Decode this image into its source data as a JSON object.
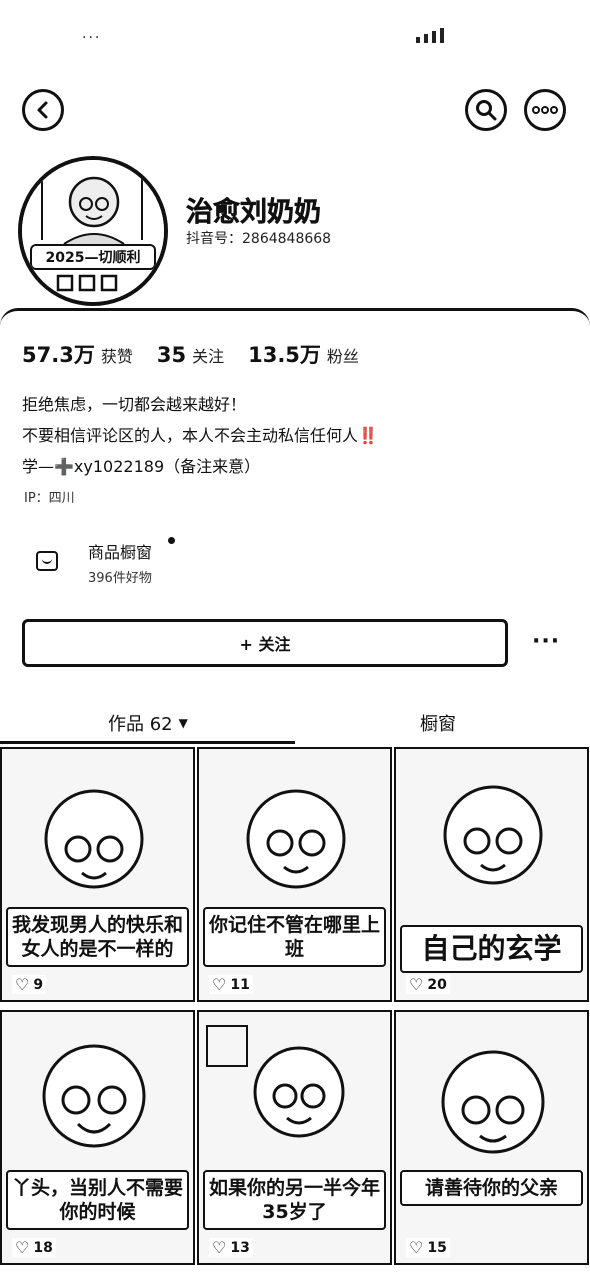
{
  "status_bar": {
    "left": "···",
    "right": ""
  },
  "nav": {},
  "profile": {
    "avatar_badge": "2025—切顺利",
    "username": "治愈刘奶奶",
    "douyin_id": "抖音号：2864848668"
  },
  "stats": [
    {
      "num": "57.3万",
      "label": "获赞"
    },
    {
      "num": "35",
      "label": "关注"
    },
    {
      "num": "13.5万",
      "label": "粉丝"
    }
  ],
  "bio": {
    "line1": "拒绝焦虑，一切都会越来越好！",
    "line2": "不要相信评论区的人，本人不会主动私信任何人‼️",
    "line3": "学—➕xy1022189（备注来意）"
  },
  "ip": "IP：四川",
  "shop": {
    "title": "商品橱窗",
    "subtitle": "396件好物"
  },
  "actions": {
    "follow": "+ 关注",
    "more": "···"
  },
  "tabs": {
    "works": "作品 62",
    "shop": "橱窗"
  },
  "videos": [
    {
      "caption": "我发现男人的快乐和女人的是不一样的",
      "likes": "9"
    },
    {
      "caption": "你记住不管在哪里上班",
      "likes": "11"
    },
    {
      "caption": "自己的玄学",
      "likes": "20"
    },
    {
      "caption": "丫头，当别人不需要你的时候",
      "likes": "18"
    },
    {
      "caption": "如果你的另一半今年35岁了",
      "likes": "13"
    },
    {
      "caption": "请善待你的父亲",
      "likes": "15"
    }
  ]
}
